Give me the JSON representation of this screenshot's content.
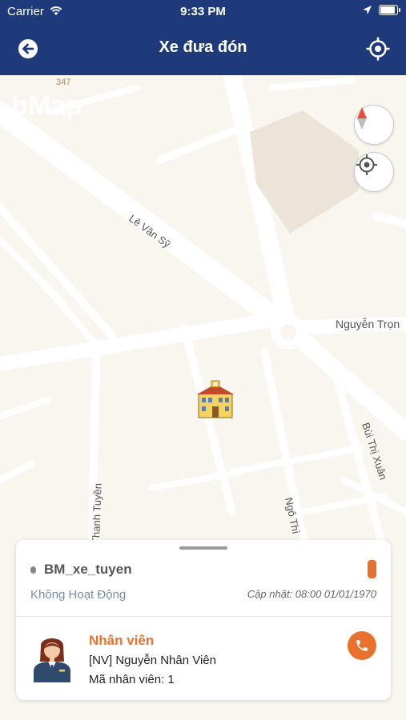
{
  "status_bar": {
    "carrier": "Carrier",
    "time": "9:33 PM"
  },
  "header": {
    "title": "Xe đưa đón"
  },
  "map": {
    "watermark": "bMap",
    "labels": {
      "route_number": "347",
      "street_le_van_sy": "Lê Văn Sỹ",
      "street_nguyen_trong": "Nguyễn Trọn",
      "street_bui_thi_xuan": "Bùi Thị Xuân",
      "street_thanh_tuyen": "Thanh Tuyền",
      "street_ngo_thi": "Ngô Thì"
    }
  },
  "vehicle": {
    "name": "BM_xe_tuyen",
    "status": "Không Hoạt Động",
    "updated": "Cập nhật: 08:00 01/01/1970"
  },
  "employee": {
    "heading": "Nhân viên",
    "name": "[NV] Nguyễn Nhân Viên",
    "code": "Mã nhân viên: 1"
  },
  "colors": {
    "header_bg": "#1f3a7b",
    "accent": "#e8722d",
    "map_bg": "#f9f5ef"
  }
}
